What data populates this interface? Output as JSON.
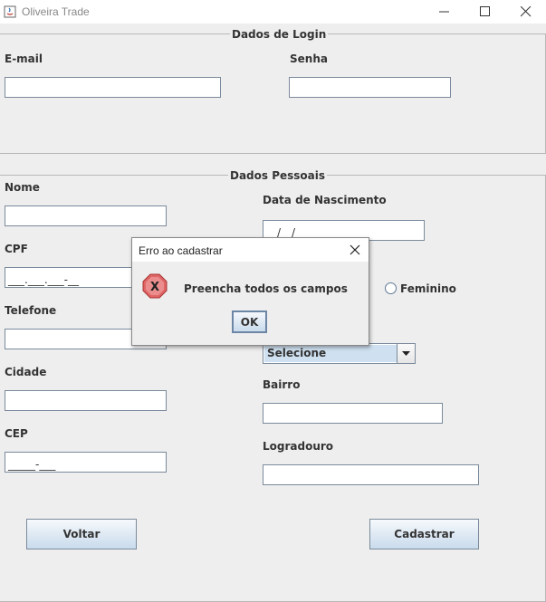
{
  "window": {
    "title": "Oliveira Trade"
  },
  "login": {
    "section_title": "Dados de Login",
    "email_label": "E-mail",
    "email_value": "",
    "password_label": "Senha",
    "password_value": ""
  },
  "personal": {
    "section_title": "Dados Pessoais",
    "nome_label": "Nome",
    "nome_value": "",
    "cpf_label": "CPF",
    "cpf_value": "___.___.___-__",
    "telefone_label": "Telefone",
    "telefone_value": "",
    "cidade_label": "Cidade",
    "cidade_value": "",
    "cep_label": "CEP",
    "cep_value": "_____-___",
    "nascimento_label": "Data de Nascimento",
    "nascimento_value": "__/__/____",
    "sexo_feminino": "Feminino",
    "estado_selected": "Selecione",
    "bairro_label": "Bairro",
    "bairro_value": "",
    "logradouro_label": "Logradouro",
    "logradouro_value": ""
  },
  "buttons": {
    "voltar": "Voltar",
    "cadastrar": "Cadastrar"
  },
  "dialog": {
    "title": "Erro ao cadastrar",
    "message": "Preencha todos os campos",
    "ok": "OK",
    "icon": "error-icon"
  },
  "colors": {
    "field_border": "#7a8a9b",
    "button_fill": "#dde8f3",
    "error_red": "#d9534f"
  }
}
